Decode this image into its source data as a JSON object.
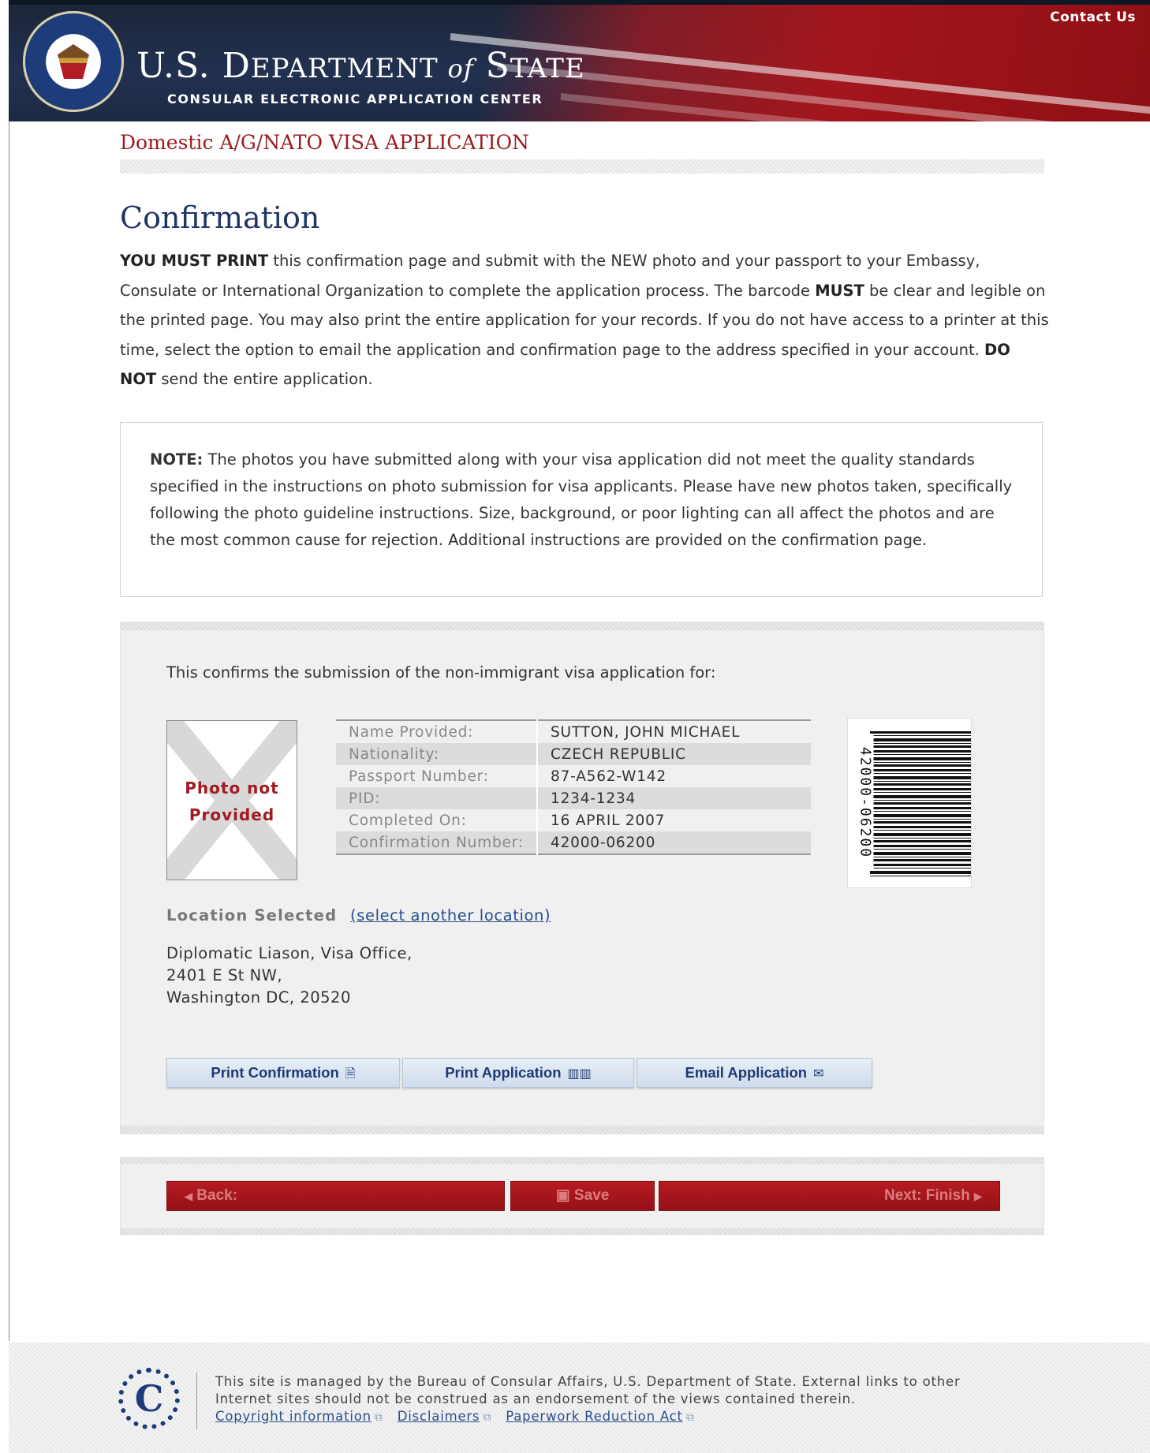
{
  "header": {
    "contact": "Contact Us",
    "dept_title": "U.S. DEPARTMENT of STATE",
    "dept_title_parts": [
      "U.S. D",
      "EPARTMENT ",
      "of",
      " S",
      "TATE"
    ],
    "dept_subtitle": "CONSULAR ELECTRONIC APPLICATION CENTER",
    "seal_icon": "state-department-seal-icon"
  },
  "app_title": "Domestic A/G/NATO VISA APPLICATION",
  "page_title": "Confirmation",
  "intro": {
    "part1_bold": "YOU MUST PRINT",
    "part2": " this confirmation page and submit with the NEW photo and your passport to your Embassy, Consulate or International Organization to complete the application process. The barcode ",
    "part3_bold": "MUST",
    "part4": " be clear and legible on the printed page. You may also print the entire application for your records.  If you do not have access to a printer at this time, select the option to email the application and confirmation page to the address specified in your account.  ",
    "part5_bold": "DO NOT",
    "part6": " send the entire application."
  },
  "note": {
    "label": "NOTE:",
    "text": " The photos you have submitted along with your visa application did not meet the quality standards specified in the instructions on photo submission for visa applicants. Please have new photos taken, specifically following the photo guideline instructions. Size, background, or poor lighting can all affect the photos and are the most common cause for rejection. Additional instructions are provided on the confirmation page."
  },
  "confirmation": {
    "confirms_text": "This confirms the submission of the non-immigrant visa application for:",
    "photo_placeholder_line1": "Photo not",
    "photo_placeholder_line2": "Provided",
    "fields": [
      {
        "label": "Name Provided:",
        "value": "SUTTON, JOHN MICHAEL"
      },
      {
        "label": "Nationality:",
        "value": "CZECH REPUBLIC"
      },
      {
        "label": "Passport Number:",
        "value": "87-A562-W142"
      },
      {
        "label": "PID:",
        "value": "1234-1234"
      },
      {
        "label": "Completed On:",
        "value": "16 APRIL 2007"
      },
      {
        "label": "Confirmation Number:",
        "value": "42000-06200"
      }
    ],
    "barcode_number": "42000-06200",
    "location_label": "Location Selected",
    "location_link": "(select another location)",
    "address_line1": "Diplomatic Liason, Visa Office,",
    "address_line2": "2401 E St NW,",
    "address_line3": "Washington DC,  20520",
    "actions": {
      "print_confirmation": "Print Confirmation",
      "print_application": "Print Application",
      "email_application": "Email Application",
      "print_confirmation_icon": "🗎",
      "print_application_icon": "▥▥",
      "email_application_icon": "✉"
    }
  },
  "nav": {
    "back": "Back:",
    "save": "Save",
    "next": "Next: Finish",
    "back_icon": "◀",
    "save_icon": "▣",
    "next_icon": "▶"
  },
  "footer": {
    "text_line1": "This site is managed by the Bureau of Consular Affairs, U.S. Department of State. External links to other",
    "text_line2": "Internet sites should not be construed as an endorsement  of the views contained therein.",
    "links": [
      "Copyright information",
      "Disclaimers",
      "Paperwork Reduction Act"
    ],
    "external_icon": "⧉"
  },
  "colors": {
    "header_blue": "#1d2a44",
    "header_red": "#a3161d",
    "title_red": "#9b1b1f",
    "title_navy": "#1f3566",
    "button_blue": "#cfdcec",
    "nav_red": "#a3161d"
  }
}
